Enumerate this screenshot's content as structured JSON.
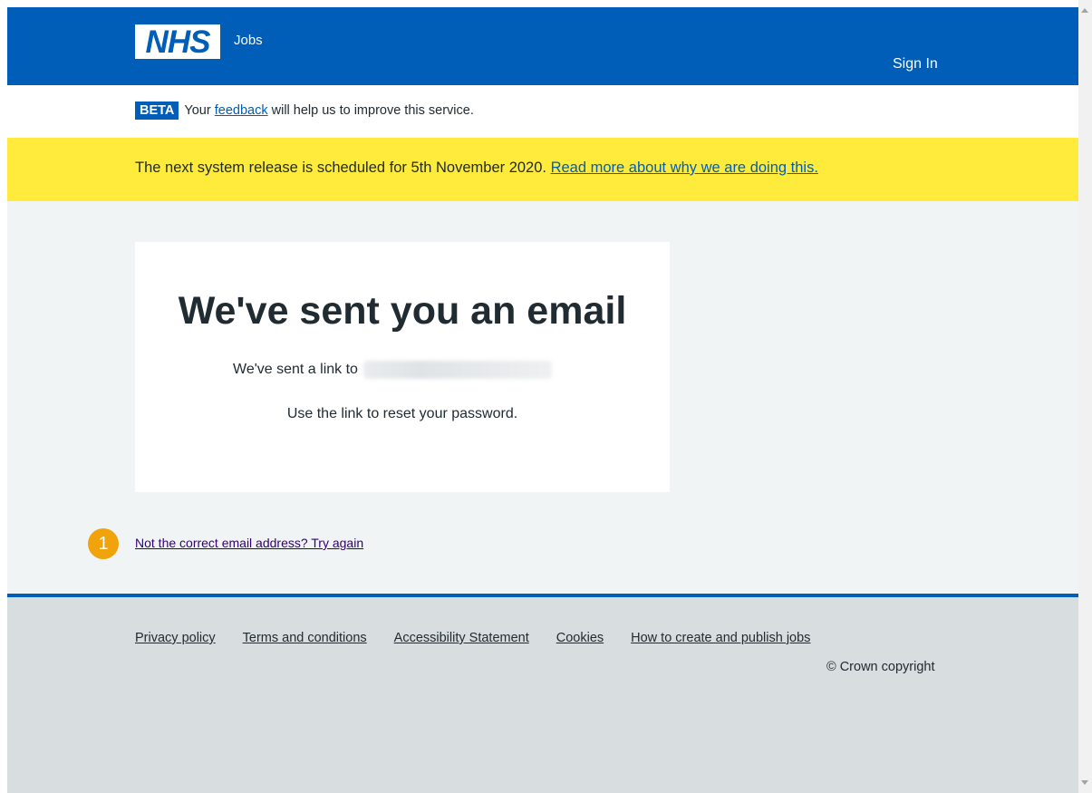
{
  "header": {
    "logo_text": "NHS",
    "service_name": "Jobs",
    "sign_in": "Sign In",
    "brand_color": "#005eb8"
  },
  "beta_banner": {
    "tag": "BETA",
    "text_before": "Your",
    "link": "feedback",
    "text_after": "will help us to improve this service."
  },
  "release_banner": {
    "text": "The next system release is scheduled for 5th November 2020.",
    "link": "Read more about why we are doing this.",
    "background": "#ffeb3b"
  },
  "card": {
    "title": "We've sent you an email",
    "sent_prefix": "We've sent a link to",
    "instruction": "Use the link to reset your password."
  },
  "retry": {
    "marker": "1",
    "link": "Not the correct email address? Try again"
  },
  "footer": {
    "links": [
      "Privacy policy",
      "Terms and conditions",
      "Accessibility Statement",
      "Cookies",
      "How to create and publish jobs"
    ],
    "copyright": "© Crown copyright"
  }
}
